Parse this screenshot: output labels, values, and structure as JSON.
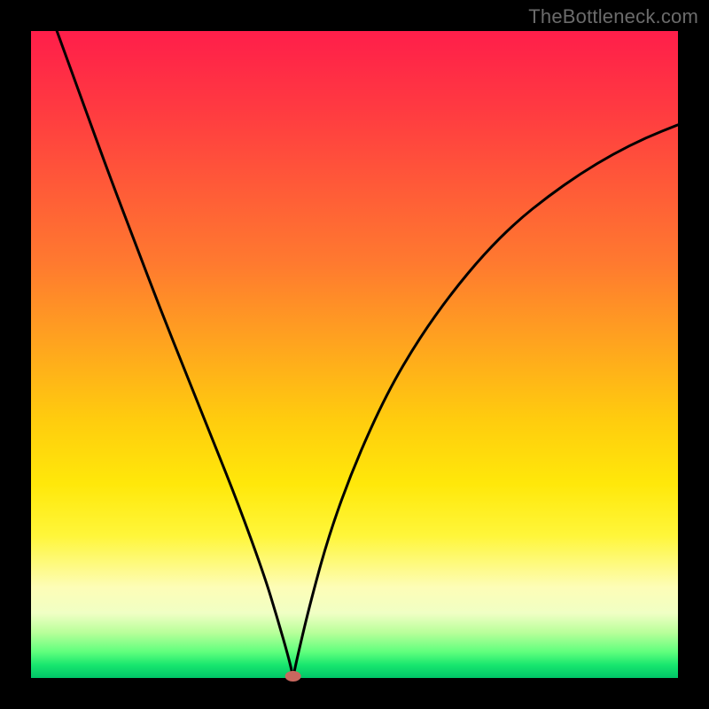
{
  "watermark": {
    "text": "TheBottleneck.com"
  },
  "chart_data": {
    "type": "line",
    "title": "",
    "xlabel": "",
    "ylabel": "",
    "xlim": [
      0,
      100
    ],
    "ylim": [
      0,
      100
    ],
    "grid": false,
    "legend": false,
    "cusp": {
      "x": 40.5,
      "y": 0
    },
    "series": [
      {
        "name": "curve",
        "x": [
          4,
          8,
          12,
          16,
          20,
          24,
          28,
          32,
          36,
          38,
          40,
          40.5,
          41,
          43,
          46,
          50,
          55,
          60,
          65,
          70,
          75,
          80,
          85,
          90,
          95,
          100
        ],
        "y": [
          100,
          89,
          78,
          67.5,
          57,
          47,
          37,
          27,
          16,
          9.5,
          2.5,
          0,
          2.5,
          11,
          22,
          33,
          44,
          52.5,
          59.5,
          65.5,
          70.5,
          74.5,
          78,
          81,
          83.5,
          85.5
        ]
      }
    ],
    "marker": {
      "x": 40.5,
      "y": 0,
      "color": "#c9685f",
      "rx": 9,
      "ry": 6
    }
  }
}
